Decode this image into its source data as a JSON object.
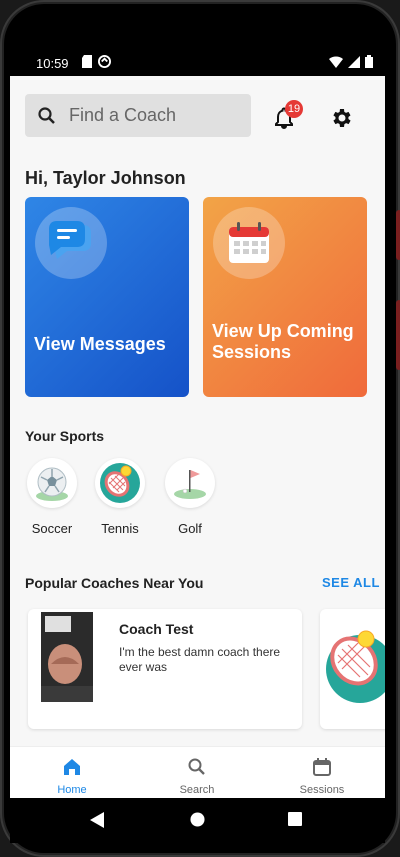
{
  "status": {
    "time": "10:59"
  },
  "search": {
    "placeholder": "Find a Coach"
  },
  "notifications": {
    "count": "19"
  },
  "greeting": "Hi, Taylor Johnson",
  "cards": {
    "messages": {
      "label": "View Messages",
      "color_from": "#2f86e6",
      "color_to": "#1552c8"
    },
    "sessions": {
      "label": "View Up Coming Sessions",
      "color_from": "#f2a447",
      "color_to": "#f06a3b"
    }
  },
  "sports": {
    "title": "Your Sports",
    "items": [
      {
        "label": "Soccer",
        "icon": "soccer-ball-icon"
      },
      {
        "label": "Tennis",
        "icon": "tennis-icon"
      },
      {
        "label": "Golf",
        "icon": "golf-icon"
      }
    ]
  },
  "coaches": {
    "title": "Popular Coaches Near You",
    "see_all": "SEE ALL",
    "items": [
      {
        "name": "Coach Test",
        "description": "I'm the best damn coach there ever was"
      }
    ]
  },
  "bottom_nav": {
    "tabs": [
      {
        "label": "Home",
        "icon": "home-icon",
        "active": true
      },
      {
        "label": "Search",
        "icon": "search-icon",
        "active": false
      },
      {
        "label": "Sessions",
        "icon": "calendar-icon",
        "active": false
      }
    ],
    "active_color": "#1e88e5"
  }
}
